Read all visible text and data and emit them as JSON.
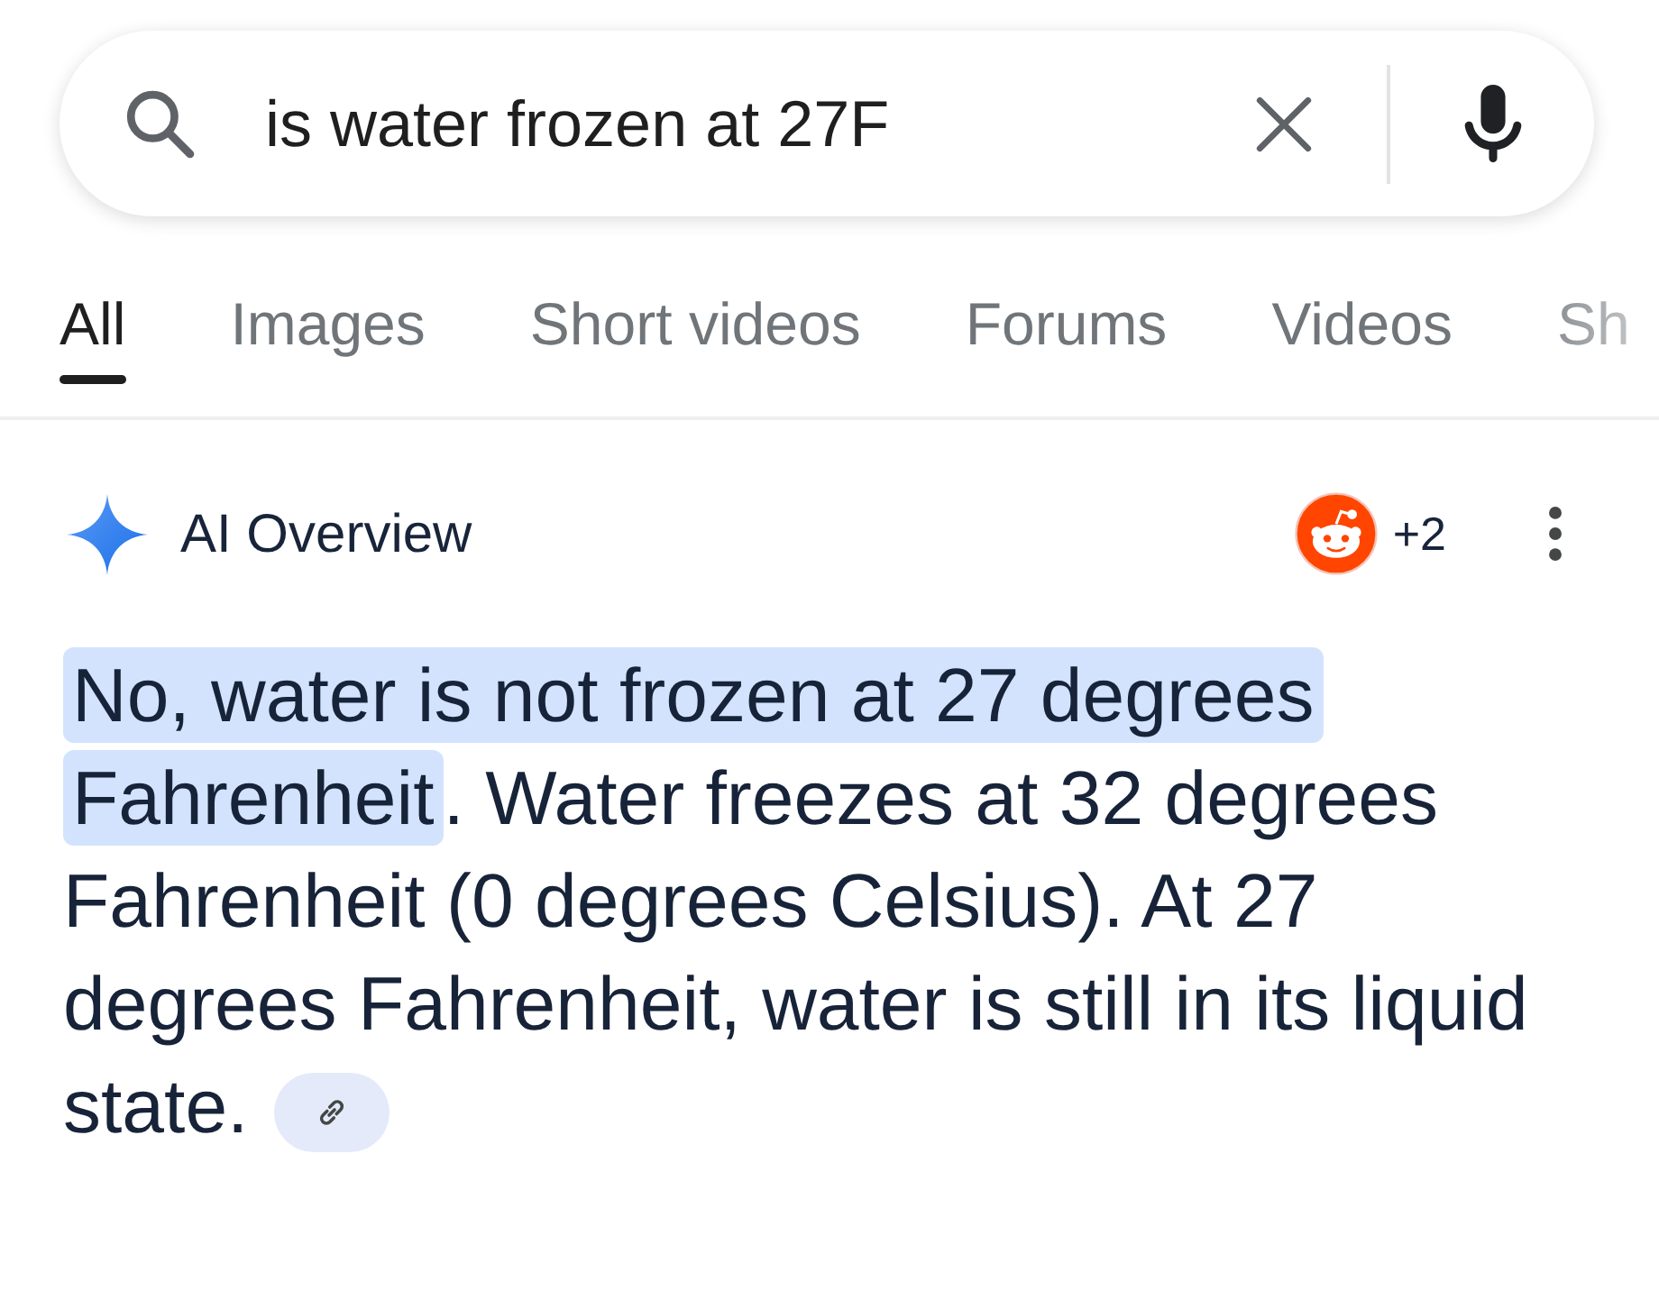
{
  "search": {
    "value": "is water frozen at 27F"
  },
  "tabs": [
    {
      "label": "All",
      "selected": true
    },
    {
      "label": "Images",
      "selected": false
    },
    {
      "label": "Short videos",
      "selected": false
    },
    {
      "label": "Forums",
      "selected": false
    },
    {
      "label": "Videos",
      "selected": false
    },
    {
      "label": "Sh",
      "selected": false
    }
  ],
  "ai_overview": {
    "title": "AI Overview",
    "sources_count": "+2"
  },
  "answer": {
    "highlight": "No, water is not frozen at 27 degrees Fahrenheit",
    "text": ". Water freezes at 32 degrees Fahrenheit (0 degrees Celsius). At 27 degrees Fahrenheit, water is still in its liquid state."
  }
}
